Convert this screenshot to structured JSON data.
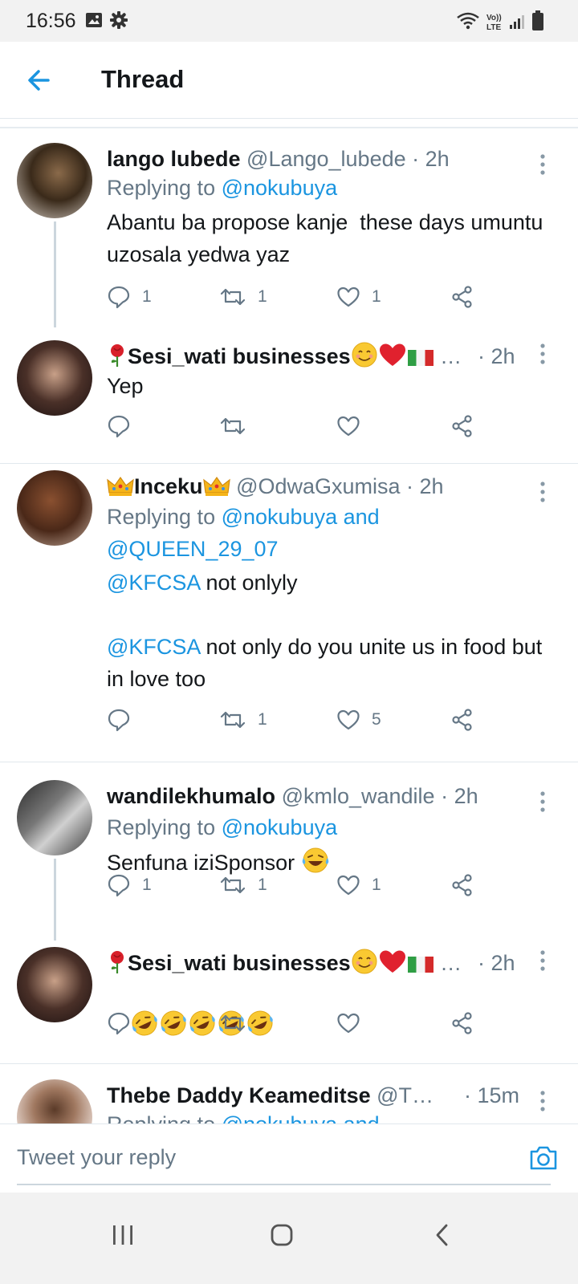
{
  "status_bar": {
    "time": "16:56"
  },
  "header": {
    "title": "Thread",
    "back_icon": "arrow-left-icon"
  },
  "colors": {
    "accent": "#1b95e0",
    "text": "#14171a",
    "muted": "#657786"
  },
  "tweets": [
    {
      "name": "lango lubede",
      "handle": "@Lango_lubede",
      "time": "· 2h",
      "replying_label": "Replying to ",
      "replying_to": "@nokubuya",
      "body": "Abantu ba propose kanje  these days umuntu uzosala yedwa yaz",
      "replies": "1",
      "retweets": "1",
      "likes": "1"
    },
    {
      "name": "Sesi_wati businesses",
      "handle": "…",
      "time": "· 2h",
      "body": "Yep",
      "replies": "",
      "retweets": "",
      "likes": ""
    },
    {
      "name": "Inceku",
      "handle": "@OdwaGxumisa",
      "time": "· 2h",
      "replying_label": "Replying to ",
      "replying_to": "@nokubuya and",
      "replying_to2": "@QUEEN_29_07",
      "mention": "@KFCSA",
      "body_line1": " not onlyly",
      "mention2": "@KFCSA",
      "body_line2": " not only do you unite us in food but in love too",
      "replies": "",
      "retweets": "1",
      "likes": "5"
    },
    {
      "name": "wandilekhumalo",
      "handle": "@kmlo_wandile",
      "time": "· 2h",
      "replying_label": "Replying to ",
      "replying_to": "@nokubuya",
      "body": "Senfuna iziSponsor",
      "replies": "1",
      "retweets": "1",
      "likes": "1"
    },
    {
      "name": "Sesi_wati businesses",
      "handle": "…",
      "time": "· 2h",
      "body": "",
      "replies": "",
      "retweets": "",
      "likes": ""
    },
    {
      "name": "Thebe Daddy Keameditse",
      "handle": "@T…",
      "time": "· 15m",
      "replying_label": "Replying to ",
      "replying_to": "@nokubuya and"
    }
  ],
  "composer": {
    "placeholder": "Tweet your reply"
  }
}
